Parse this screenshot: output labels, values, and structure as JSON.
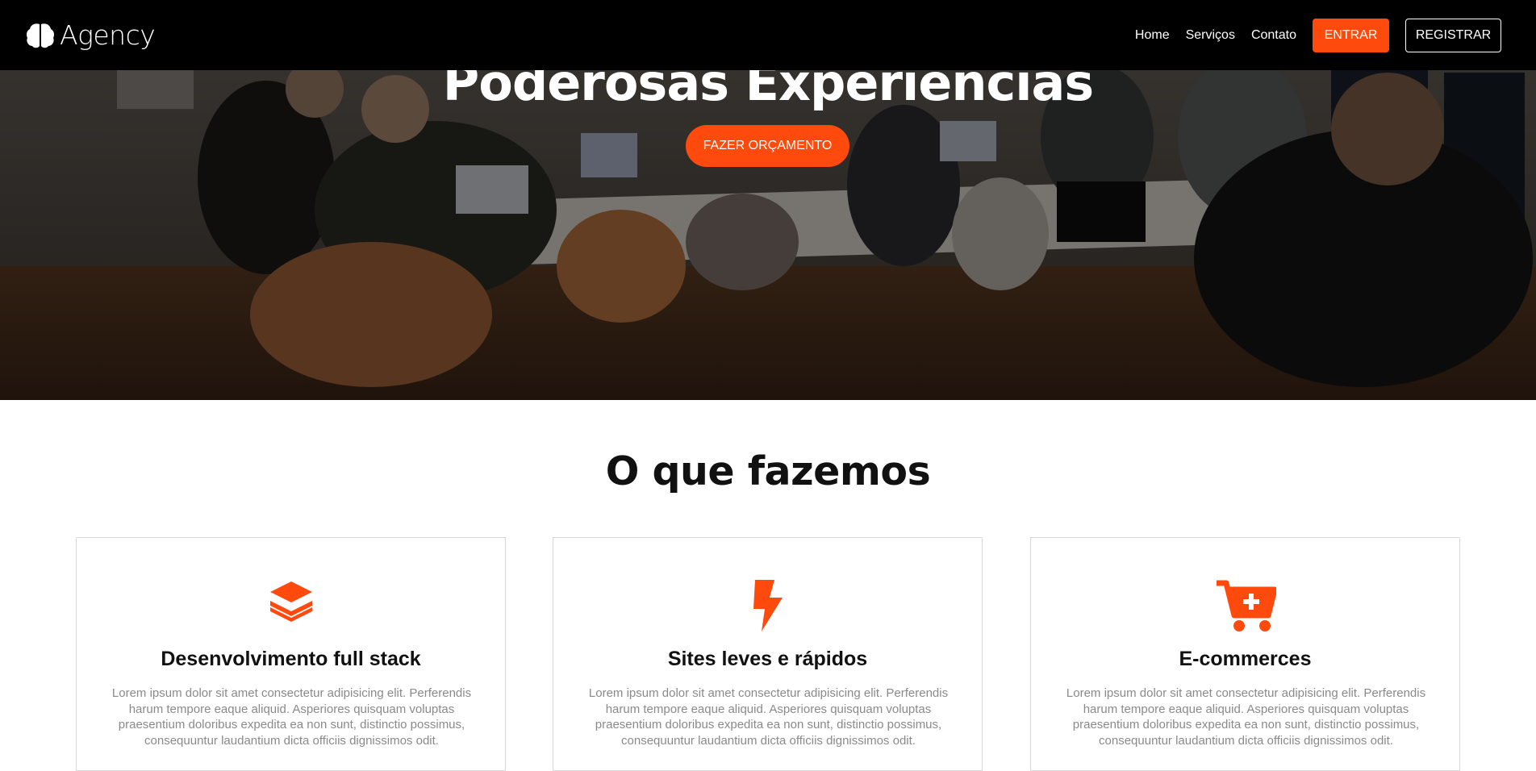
{
  "navbar": {
    "brand": "Agency",
    "links": [
      "Home",
      "Serviços",
      "Contato"
    ],
    "login_label": "ENTRAR",
    "register_label": "REGISTRAR"
  },
  "hero": {
    "title": "Poderosas Experiências",
    "cta_label": "FAZER ORÇAMENTO"
  },
  "services": {
    "title": "O que fazemos",
    "cards": [
      {
        "icon": "layers-icon",
        "title": "Desenvolvimento full stack",
        "text": "Lorem ipsum dolor sit amet consectetur adipisicing elit. Perferendis harum tempore eaque aliquid. Asperiores quisquam voluptas praesentium doloribus expedita ea non sunt, distinctio possimus, consequuntur laudantium dicta officiis dignissimos odit."
      },
      {
        "icon": "lightning-icon",
        "title": "Sites leves e rápidos",
        "text": "Lorem ipsum dolor sit amet consectetur adipisicing elit. Perferendis harum tempore eaque aliquid. Asperiores quisquam voluptas praesentium doloribus expedita ea non sunt, distinctio possimus, consequuntur laudantium dicta officiis dignissimos odit."
      },
      {
        "icon": "cart-plus-icon",
        "title": "E-commerces",
        "text": "Lorem ipsum dolor sit amet consectetur adipisicing elit. Perferendis harum tempore eaque aliquid. Asperiores quisquam voluptas praesentium doloribus expedita ea non sunt, distinctio possimus, consequuntur laudantium dicta officiis dignissimos odit."
      }
    ]
  },
  "colors": {
    "accent": "#ff4a0e",
    "navbar_bg": "#000000"
  }
}
